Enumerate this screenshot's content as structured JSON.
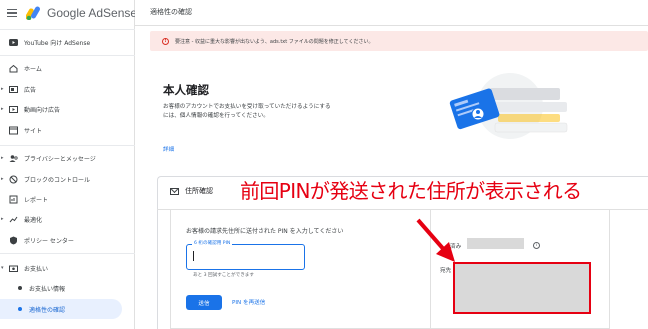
{
  "app": {
    "name": "Google AdSense"
  },
  "header": {
    "title": "適格性の確認"
  },
  "sidebar": {
    "top_item": "YouTube 向け AdSense",
    "items": [
      {
        "label": "ホーム",
        "icon": "home-icon",
        "caret": false
      },
      {
        "label": "広告",
        "icon": "ads-icon",
        "caret": true
      },
      {
        "label": "動画向け広告",
        "icon": "video-ads-icon",
        "caret": true
      },
      {
        "label": "サイト",
        "icon": "sites-icon",
        "caret": false
      },
      {
        "label": "プライバシーとメッセージ",
        "icon": "privacy-icon",
        "caret": true
      },
      {
        "label": "ブロックのコントロール",
        "icon": "block-icon",
        "caret": true
      },
      {
        "label": "レポート",
        "icon": "report-icon",
        "caret": false
      },
      {
        "label": "最適化",
        "icon": "optimize-icon",
        "caret": true
      },
      {
        "label": "ポリシー センター",
        "icon": "policy-icon",
        "caret": false
      },
      {
        "label": "お支払い",
        "icon": "payments-icon",
        "caret": true
      }
    ],
    "sub_items": [
      {
        "label": "お支払い情報"
      },
      {
        "label": "適格性の確認",
        "active": true
      }
    ]
  },
  "alert": {
    "text": "要注意 - 収益に重大な影響が出ないよう、ads.txt ファイルの問題を修正してください。"
  },
  "main": {
    "title": "本人確認",
    "description": "お客様のアカウントでお支払いを受け取っていただけるようにするには、個人情報の確認を行ってください。",
    "details_link": "詳細"
  },
  "section": {
    "title": "住所確認",
    "prompt": "お客様の請求先住所に送付された PIN を入力してください",
    "pin_field_label": "6 桁の確認用 PIN",
    "pin_value": "",
    "attempts_text": "あと 3 回試すことができます",
    "submit_label": "送信",
    "resend_label": "PIN を再送信",
    "sent_label": "済み",
    "address_label": "宛先",
    "info_icon_text": "i"
  },
  "annotation": {
    "text": "前回PINが発送された住所が表示される"
  },
  "colors": {
    "accent": "#1a73e8",
    "annotation_red": "#e60012",
    "alert_bg": "#fce8e6"
  }
}
